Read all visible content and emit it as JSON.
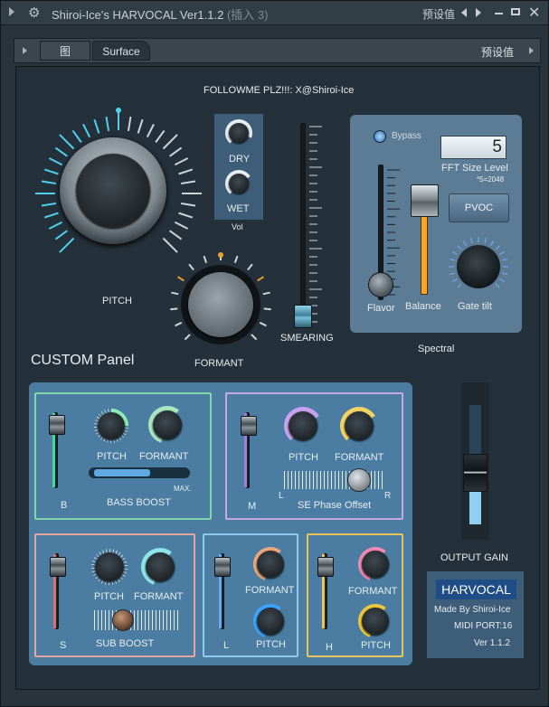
{
  "window": {
    "title": "Shiroi-Ice's HARVOCAL Ver1.1.2",
    "subtitle": "(插入 3)",
    "preset_label": "预设值"
  },
  "toolbar": {
    "tab_graph": "图",
    "tab_surface": "Surface",
    "preset_label": "预设值"
  },
  "header": {
    "followme": "FOLLOWME PLZ!!!: X@Shiroi-Ice"
  },
  "main": {
    "pitch_label": "PITCH",
    "formant_label": "FORMANT",
    "drywet": {
      "dry": "DRY",
      "wet": "WET",
      "vol": "Vol"
    },
    "smearing_label": "SMEARING"
  },
  "spectral": {
    "bypass": "Bypass",
    "fft_value": "5",
    "fft_label": "FFT Size Level",
    "fft_note": "*5=2048",
    "pvoc": "PVOC",
    "flavor": "Flavor",
    "balance": "Balance",
    "gate_tilt": "Gate tilt",
    "title": "Spectral"
  },
  "custom": {
    "title": "CUSTOM Panel",
    "b": {
      "letter": "B",
      "pitch": "PITCH",
      "formant": "FORMANT",
      "bass_boost": "BASS BOOST",
      "max": "MAX."
    },
    "m": {
      "letter": "M",
      "pitch": "PITCH",
      "formant": "FORMANT",
      "phase": "SE Phase Offset",
      "l": "L",
      "r": "R"
    },
    "s": {
      "letter": "S",
      "pitch": "PITCH",
      "formant": "FORMANT",
      "sub_boost": "SUB BOOST"
    },
    "l": {
      "letter": "L",
      "formant": "FORMANT",
      "pitch": "PITCH"
    },
    "h": {
      "letter": "H",
      "formant": "FORMANT",
      "pitch": "PITCH"
    }
  },
  "output": {
    "gain_label": "OUTPUT GAIN"
  },
  "info": {
    "brand": "HARVOCAL",
    "made_by": "Made By Shiroi-Ice",
    "midi": "MIDI PORT:16",
    "version": "Ver 1.1.2"
  },
  "colors": {
    "accent": "#53d3f0",
    "panel_b": "#7fd6a8",
    "panel_m": "#c9a7e3",
    "panel_s": "#e6a6a0",
    "panel_l": "#8fc7ef",
    "panel_h": "#e8c45a",
    "orange": "#f0a030"
  }
}
